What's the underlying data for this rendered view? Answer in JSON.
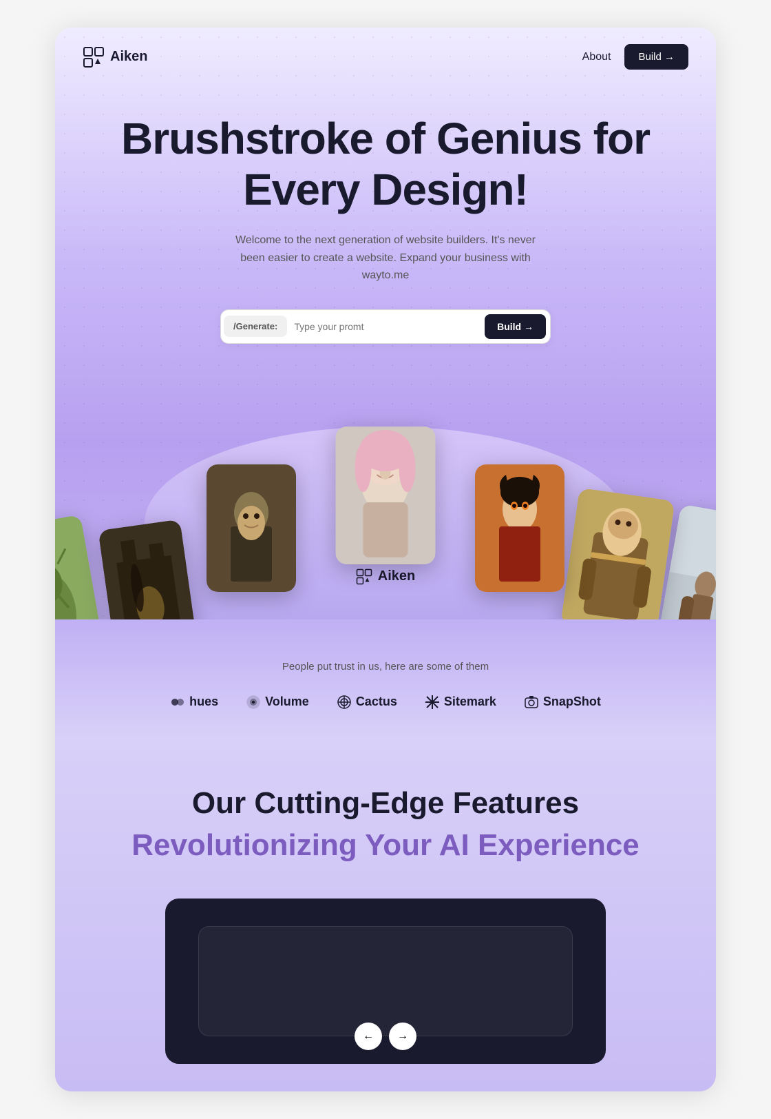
{
  "nav": {
    "logo_text": "Aiken",
    "about_label": "About",
    "build_label": "Build →"
  },
  "hero": {
    "title": "Brushstroke of Genius for Every Design!",
    "subtitle": "Welcome to the next generation of website builders. It's never been easier to create a website. Expand your business with wayto.me",
    "generate_label": "/Generate:",
    "generate_placeholder": "Type your promt",
    "build_label": "Build →"
  },
  "arc": {
    "logo_text": "Aiken"
  },
  "trust": {
    "label": "People put trust in us, here are some of them",
    "logos": [
      {
        "name": "hues",
        "label": "hues",
        "icon": "◈"
      },
      {
        "name": "volume",
        "label": "Volume",
        "icon": "⊕"
      },
      {
        "name": "cactus",
        "label": "Cactus",
        "icon": "⊗"
      },
      {
        "name": "sitemark",
        "label": "Sitemark",
        "icon": "✳"
      },
      {
        "name": "snapshot",
        "label": "SnapShot",
        "icon": "⊟"
      }
    ]
  },
  "features": {
    "title": "Our Cutting-Edge Features",
    "subtitle": "Revolutionizing Your AI Experience"
  },
  "cards": [
    {
      "id": "center",
      "color": "#c8b8a0",
      "desc": "Portrait illustration"
    },
    {
      "id": "left1",
      "color": "#8a7050",
      "desc": "Dark fantasy art"
    },
    {
      "id": "left2",
      "color": "#6a5840",
      "desc": "Castle dark art"
    },
    {
      "id": "left3",
      "color": "#7a9060",
      "desc": "Green creature"
    },
    {
      "id": "right1",
      "color": "#c87840",
      "desc": "Anime character"
    },
    {
      "id": "right2",
      "color": "#c0a878",
      "desc": "Sci-fi character"
    },
    {
      "id": "right3",
      "color": "#c8d0d8",
      "desc": "Post-apocalyptic"
    }
  ]
}
